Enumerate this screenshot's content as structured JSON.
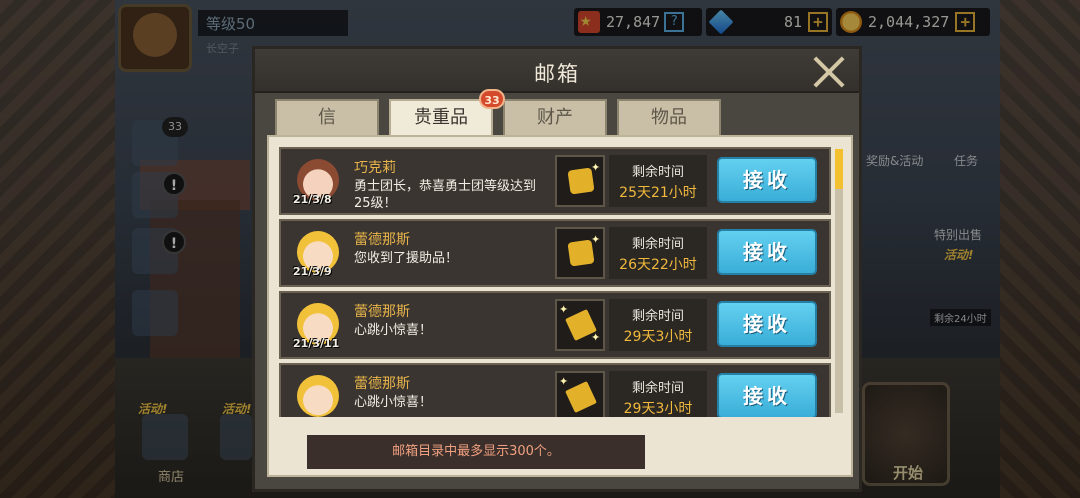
{
  "hud": {
    "player_level": "等级50",
    "player_name": "长空子",
    "stars": "27,847",
    "stars_help": "?",
    "gems": "81",
    "gold": "2,044,327",
    "plus": "+"
  },
  "background": {
    "left_badge": "33",
    "alert_1": "!",
    "alert_2": "!",
    "activity_tag_1": "活动!",
    "activity_tag_2": "活动!",
    "shop_label": "商店",
    "right_events_label": "奖励&活动",
    "right_task_label": "任务",
    "right_sale_label": "特别出售",
    "right_sale_tag": "活动!",
    "right_countdown": "剩余24小时",
    "start_label": "开始"
  },
  "dialog": {
    "title": "邮箱",
    "tabs": [
      {
        "label": "信",
        "active": false
      },
      {
        "label": "贵重品",
        "active": true
      },
      {
        "label": "财产",
        "active": false
      },
      {
        "label": "物品",
        "active": false
      }
    ],
    "tab_badge": "33",
    "receive_label": "接收",
    "time_label": "剩余时间",
    "mails": [
      {
        "sender": "巧克莉",
        "date": "21/3/8",
        "message": "勇士团长，恭喜勇士团等级达到25级！",
        "time_left": "25天21小时",
        "avatar": "brown"
      },
      {
        "sender": "蕾德那斯",
        "date": "21/3/9",
        "message": "您收到了援助品！",
        "time_left": "26天22小时",
        "avatar": "blonde"
      },
      {
        "sender": "蕾德那斯",
        "date": "21/3/11",
        "message": "心跳小惊喜！",
        "time_left": "29天3小时",
        "avatar": "blonde"
      },
      {
        "sender": "蕾德那斯",
        "date": "",
        "message": "心跳小惊喜！",
        "time_left": "29天3小时",
        "avatar": "blonde"
      }
    ],
    "notice": "邮箱目录中最多显示300个。"
  }
}
